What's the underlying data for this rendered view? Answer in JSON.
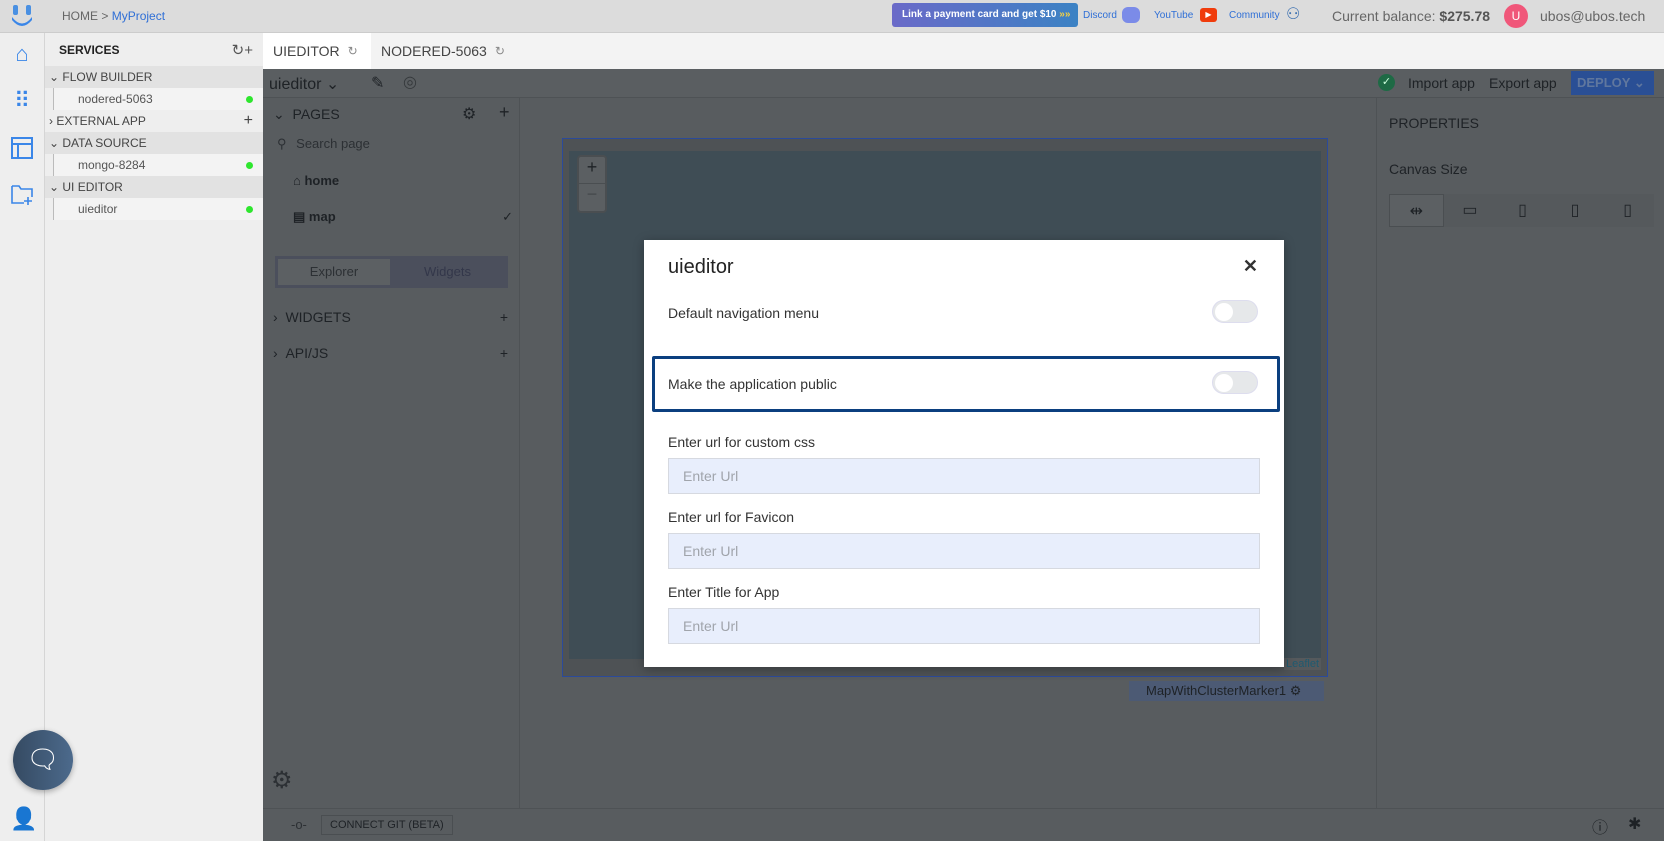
{
  "topbar": {
    "breadcrumb_home": "HOME",
    "breadcrumb_sep": ">",
    "breadcrumb_project": "MyProject",
    "promo": "Link a payment card and get $10",
    "discord": "Discord",
    "youtube": "YouTube",
    "community": "Community",
    "balance_label": "Current balance:",
    "balance_value": "$275.78",
    "avatar_letter": "U",
    "user_email": "ubos@ubos.tech"
  },
  "services": {
    "title": "SERVICES",
    "groups": [
      {
        "label": "FLOW BUILDER",
        "items": [
          "nodered-5063"
        ]
      },
      {
        "label": "EXTERNAL APP"
      },
      {
        "label": "DATA SOURCE",
        "items": [
          "mongo-8284"
        ]
      },
      {
        "label": "UI EDITOR",
        "items": [
          "uieditor"
        ]
      }
    ]
  },
  "tabs": [
    {
      "label": "UIEDITOR"
    },
    {
      "label": "NODERED-5063"
    }
  ],
  "editor": {
    "app_name": "uieditor",
    "import": "Import app",
    "export": "Export app",
    "deploy": "DEPLOY",
    "pages_title": "PAGES",
    "search_placeholder": "Search page",
    "pages": [
      "home",
      "map"
    ],
    "explorer": "Explorer",
    "widgets_tab": "Widgets",
    "widgets": "WIDGETS",
    "apijs": "API/JS",
    "properties": "PROPERTIES",
    "canvas_size": "Canvas Size",
    "map_zoom_in": "+",
    "map_zoom_out": "−",
    "leaflet": "Leaflet",
    "widget_label": "MapWithClusterMarker1",
    "connect_git": "CONNECT GIT (BETA)"
  },
  "modal": {
    "title": "uieditor",
    "close": "✕",
    "default_nav": "Default navigation menu",
    "default_nav_on": false,
    "make_public": "Make the application public",
    "make_public_on": false,
    "css_label": "Enter url for custom css",
    "favicon_label": "Enter url for Favicon",
    "title_label": "Enter Title for App",
    "placeholder": "Enter Url"
  },
  "colors": {
    "accent": "#3a86e8",
    "highlight": "#0b3f7f",
    "deploy": "#3a6fd0",
    "status_green": "#2ee62e"
  }
}
